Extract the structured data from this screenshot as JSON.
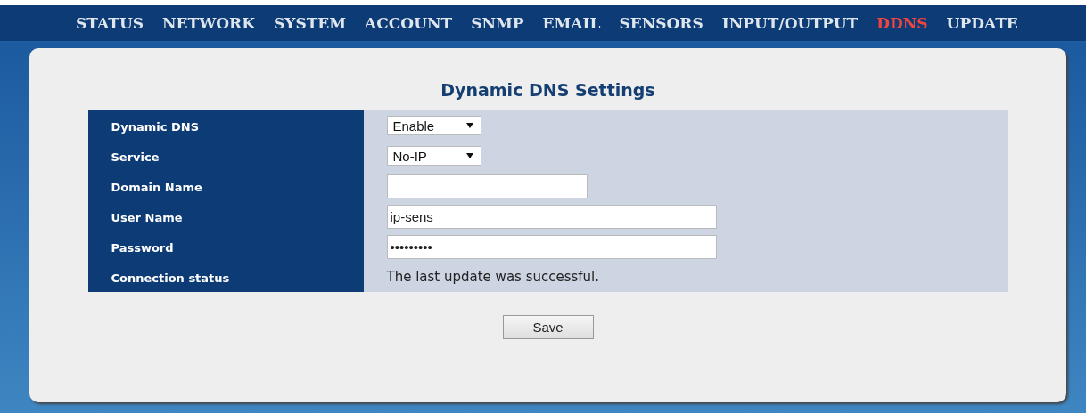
{
  "nav": [
    {
      "label": "STATUS",
      "selected": false
    },
    {
      "label": "NETWORK",
      "selected": false
    },
    {
      "label": "SYSTEM",
      "selected": false
    },
    {
      "label": "ACCOUNT",
      "selected": false
    },
    {
      "label": "SNMP",
      "selected": false
    },
    {
      "label": "EMAIL",
      "selected": false
    },
    {
      "label": "SENSORS",
      "selected": false
    },
    {
      "label": "INPUT/OUTPUT",
      "selected": false
    },
    {
      "label": "DDNS",
      "selected": true
    },
    {
      "label": "UPDATE",
      "selected": false
    }
  ],
  "title": "Dynamic DNS Settings",
  "fields": [
    {
      "label": "Dynamic DNS",
      "kind": "select",
      "value": "Enable"
    },
    {
      "label": "Service",
      "kind": "select",
      "value": "No-IP"
    },
    {
      "label": "Domain Name",
      "kind": "short_input"
    },
    {
      "label": "User Name",
      "kind": "input",
      "value": "ip-sens"
    },
    {
      "label": "Password",
      "kind": "input",
      "value": "•••••••••"
    },
    {
      "label": "Connection status",
      "kind": "text",
      "value": "The last update was successful."
    }
  ],
  "save_button": "Save"
}
